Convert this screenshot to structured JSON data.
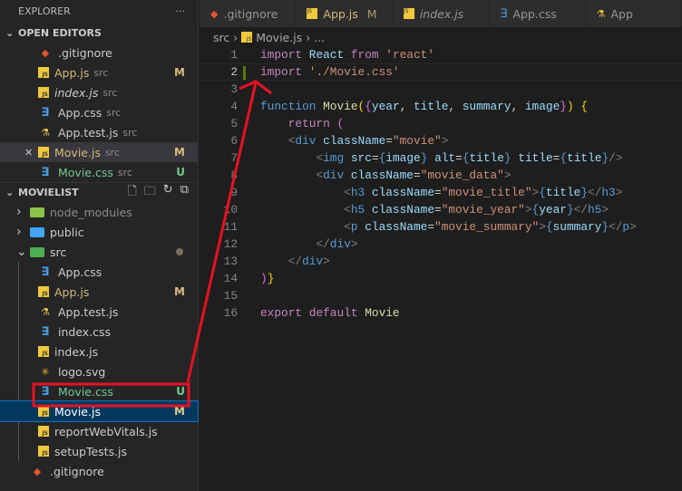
{
  "sidebar": {
    "title": "EXPLORER",
    "more": "···",
    "open_editors": {
      "label": "OPEN EDITORS",
      "items": [
        {
          "name": ".gitignore",
          "icon": "git",
          "desc": "",
          "badge": ""
        },
        {
          "name": "App.js",
          "icon": "js",
          "desc": "src",
          "badge": "M"
        },
        {
          "name": "index.js",
          "icon": "js",
          "desc": "src",
          "badge": "",
          "italic": true
        },
        {
          "name": "App.css",
          "icon": "css",
          "desc": "src",
          "badge": ""
        },
        {
          "name": "App.test.js",
          "icon": "test",
          "desc": "src",
          "badge": ""
        },
        {
          "name": "Movie.js",
          "icon": "js",
          "desc": "src",
          "badge": "M",
          "close": true
        },
        {
          "name": "Movie.css",
          "icon": "css",
          "desc": "src",
          "badge": "U"
        }
      ]
    },
    "project": {
      "label": "MOVIELIST",
      "items": [
        {
          "name": "node_modules",
          "icon": "folder-node",
          "indent": 1,
          "chev": "›",
          "dim": true
        },
        {
          "name": "public",
          "icon": "folder-public",
          "indent": 1,
          "chev": "›"
        },
        {
          "name": "src",
          "icon": "folder-src",
          "indent": 1,
          "chev": "⌄",
          "dot": true
        },
        {
          "name": "App.css",
          "icon": "css",
          "indent": 2
        },
        {
          "name": "App.js",
          "icon": "js",
          "indent": 2,
          "badge": "M"
        },
        {
          "name": "App.test.js",
          "icon": "test",
          "indent": 2
        },
        {
          "name": "index.css",
          "icon": "css",
          "indent": 2
        },
        {
          "name": "index.js",
          "icon": "js",
          "indent": 2
        },
        {
          "name": "logo.svg",
          "icon": "svg",
          "indent": 2
        },
        {
          "name": "Movie.css",
          "icon": "css",
          "indent": 2,
          "badge": "U"
        },
        {
          "name": "Movie.js",
          "icon": "js",
          "indent": 2,
          "badge": "M",
          "selected": true
        },
        {
          "name": "reportWebVitals.js",
          "icon": "js",
          "indent": 2
        },
        {
          "name": "setupTests.js",
          "icon": "js",
          "indent": 2
        },
        {
          "name": ".gitignore",
          "icon": "git",
          "indent": 1
        }
      ]
    }
  },
  "tabs": [
    {
      "label": ".gitignore",
      "icon": "git"
    },
    {
      "label": "App.js",
      "icon": "js",
      "badge": "M"
    },
    {
      "label": "index.js",
      "icon": "js",
      "italic": true
    },
    {
      "label": "App.css",
      "icon": "css"
    },
    {
      "label": "App",
      "icon": "test"
    }
  ],
  "breadcrumb": {
    "folder": "src",
    "file": "Movie.js",
    "more": "..."
  },
  "colors": {
    "annotation": "#e81123",
    "modified": "#d7ba7d",
    "untracked": "#73c991"
  },
  "code": [
    [
      [
        "kw",
        "import"
      ],
      [
        "id",
        " "
      ],
      [
        "vr",
        "React"
      ],
      [
        "id",
        " "
      ],
      [
        "kw",
        "from"
      ],
      [
        "id",
        " "
      ],
      [
        "st",
        "'react'"
      ]
    ],
    [
      [
        "kw",
        "import"
      ],
      [
        "id",
        " "
      ],
      [
        "st",
        "'./Movie.css'"
      ]
    ],
    [],
    [
      [
        "fn",
        "function"
      ],
      [
        "id",
        " "
      ],
      [
        "nm",
        "Movie"
      ],
      [
        "b1",
        "("
      ],
      [
        "b2",
        "{"
      ],
      [
        "vr",
        "year"
      ],
      [
        "pn",
        ", "
      ],
      [
        "vr",
        "title"
      ],
      [
        "pn",
        ", "
      ],
      [
        "vr",
        "summary"
      ],
      [
        "pn",
        ", "
      ],
      [
        "vr",
        "image"
      ],
      [
        "b2",
        "}"
      ],
      [
        "b1",
        ")"
      ],
      [
        "id",
        " "
      ],
      [
        "b1",
        "{"
      ]
    ],
    [
      [
        "id",
        "    "
      ],
      [
        "kw",
        "return"
      ],
      [
        "id",
        " "
      ],
      [
        "b2",
        "("
      ]
    ],
    [
      [
        "id",
        "    "
      ],
      [
        "tg",
        "<"
      ],
      [
        "tn",
        "div"
      ],
      [
        "id",
        " "
      ],
      [
        "vr",
        "className"
      ],
      [
        "pn",
        "="
      ],
      [
        "st",
        "\"movie\""
      ],
      [
        "tg",
        ">"
      ]
    ],
    [
      [
        "id",
        "        "
      ],
      [
        "tg",
        "<"
      ],
      [
        "tn",
        "img"
      ],
      [
        "id",
        " "
      ],
      [
        "vr",
        "src"
      ],
      [
        "pn",
        "="
      ],
      [
        "fn",
        "{"
      ],
      [
        "vr",
        "image"
      ],
      [
        "fn",
        "}"
      ],
      [
        "id",
        " "
      ],
      [
        "vr",
        "alt"
      ],
      [
        "pn",
        "="
      ],
      [
        "fn",
        "{"
      ],
      [
        "vr",
        "title"
      ],
      [
        "fn",
        "}"
      ],
      [
        "id",
        " "
      ],
      [
        "vr",
        "title"
      ],
      [
        "pn",
        "="
      ],
      [
        "fn",
        "{"
      ],
      [
        "vr",
        "title"
      ],
      [
        "fn",
        "}"
      ],
      [
        "tg",
        "/>"
      ]
    ],
    [
      [
        "id",
        "        "
      ],
      [
        "tg",
        "<"
      ],
      [
        "tn",
        "div"
      ],
      [
        "id",
        " "
      ],
      [
        "vr",
        "className"
      ],
      [
        "pn",
        "="
      ],
      [
        "st",
        "\"movie_data\""
      ],
      [
        "tg",
        ">"
      ]
    ],
    [
      [
        "id",
        "            "
      ],
      [
        "tg",
        "<"
      ],
      [
        "tn",
        "h3"
      ],
      [
        "id",
        " "
      ],
      [
        "vr",
        "className"
      ],
      [
        "pn",
        "="
      ],
      [
        "st",
        "\"movie_title\""
      ],
      [
        "tg",
        ">"
      ],
      [
        "fn",
        "{"
      ],
      [
        "vr",
        "title"
      ],
      [
        "fn",
        "}"
      ],
      [
        "tg",
        "</"
      ],
      [
        "tn",
        "h3"
      ],
      [
        "tg",
        ">"
      ]
    ],
    [
      [
        "id",
        "            "
      ],
      [
        "tg",
        "<"
      ],
      [
        "tn",
        "h5"
      ],
      [
        "id",
        " "
      ],
      [
        "vr",
        "className"
      ],
      [
        "pn",
        "="
      ],
      [
        "st",
        "\"movie_year\""
      ],
      [
        "tg",
        ">"
      ],
      [
        "fn",
        "{"
      ],
      [
        "vr",
        "year"
      ],
      [
        "fn",
        "}"
      ],
      [
        "tg",
        "</"
      ],
      [
        "tn",
        "h5"
      ],
      [
        "tg",
        ">"
      ]
    ],
    [
      [
        "id",
        "            "
      ],
      [
        "tg",
        "<"
      ],
      [
        "tn",
        "p"
      ],
      [
        "id",
        " "
      ],
      [
        "vr",
        "className"
      ],
      [
        "pn",
        "="
      ],
      [
        "st",
        "\"movie_summary\""
      ],
      [
        "tg",
        ">"
      ],
      [
        "fn",
        "{"
      ],
      [
        "vr",
        "summary"
      ],
      [
        "fn",
        "}"
      ],
      [
        "tg",
        "</"
      ],
      [
        "tn",
        "p"
      ],
      [
        "tg",
        ">"
      ]
    ],
    [
      [
        "id",
        "        "
      ],
      [
        "tg",
        "</"
      ],
      [
        "tn",
        "div"
      ],
      [
        "tg",
        ">"
      ]
    ],
    [
      [
        "id",
        "    "
      ],
      [
        "tg",
        "</"
      ],
      [
        "tn",
        "div"
      ],
      [
        "tg",
        ">"
      ]
    ],
    [
      [
        "b2",
        ")"
      ],
      [
        "b1",
        "}"
      ]
    ],
    [],
    [
      [
        "kw",
        "export"
      ],
      [
        "id",
        " "
      ],
      [
        "kw",
        "default"
      ],
      [
        "id",
        " "
      ],
      [
        "nm",
        "Movie"
      ]
    ]
  ]
}
